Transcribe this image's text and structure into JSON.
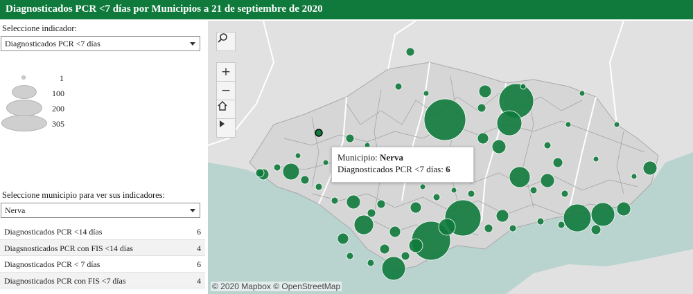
{
  "title": "Diagnosticados PCR <7 días por Municipios a 21 de septiembre de 2020",
  "indicator_select": {
    "label": "Seleccione indicador:",
    "value": "Diagnosticados PCR <7 días"
  },
  "size_legend": [
    {
      "value": "1"
    },
    {
      "value": "100"
    },
    {
      "value": "200"
    },
    {
      "value": "305"
    }
  ],
  "municipio_select": {
    "label": "Seleccione municipio para ver sus indicadores:",
    "value": "Nerva"
  },
  "indicators": [
    {
      "label": "Diagnosticados PCR <14 días",
      "value": "6"
    },
    {
      "label": "Diagsnosticados PCR con FIS <14 días",
      "value": "4"
    },
    {
      "label": "Diagnosticados PCR < 7 días",
      "value": "6"
    },
    {
      "label": "Diagnosticados PCR con FIS <7 días",
      "value": "4"
    }
  ],
  "map": {
    "attribution": "© 2020 Mapbox  © OpenStreetMap",
    "tooltip": {
      "municipio_label": "Municipio:",
      "municipio_value": "Nerva",
      "indicator_label": "Diagnosticados PCR <7 días:",
      "indicator_value": "6"
    },
    "controls": [
      "search-icon",
      "zoom-in-icon",
      "zoom-out-icon",
      "home-icon",
      "play-icon"
    ],
    "colors": {
      "land": "#dcdcdc",
      "sea": "#b9d3cf",
      "marker": "#0f7a3c",
      "title_bar": "#0f7a3c"
    }
  }
}
